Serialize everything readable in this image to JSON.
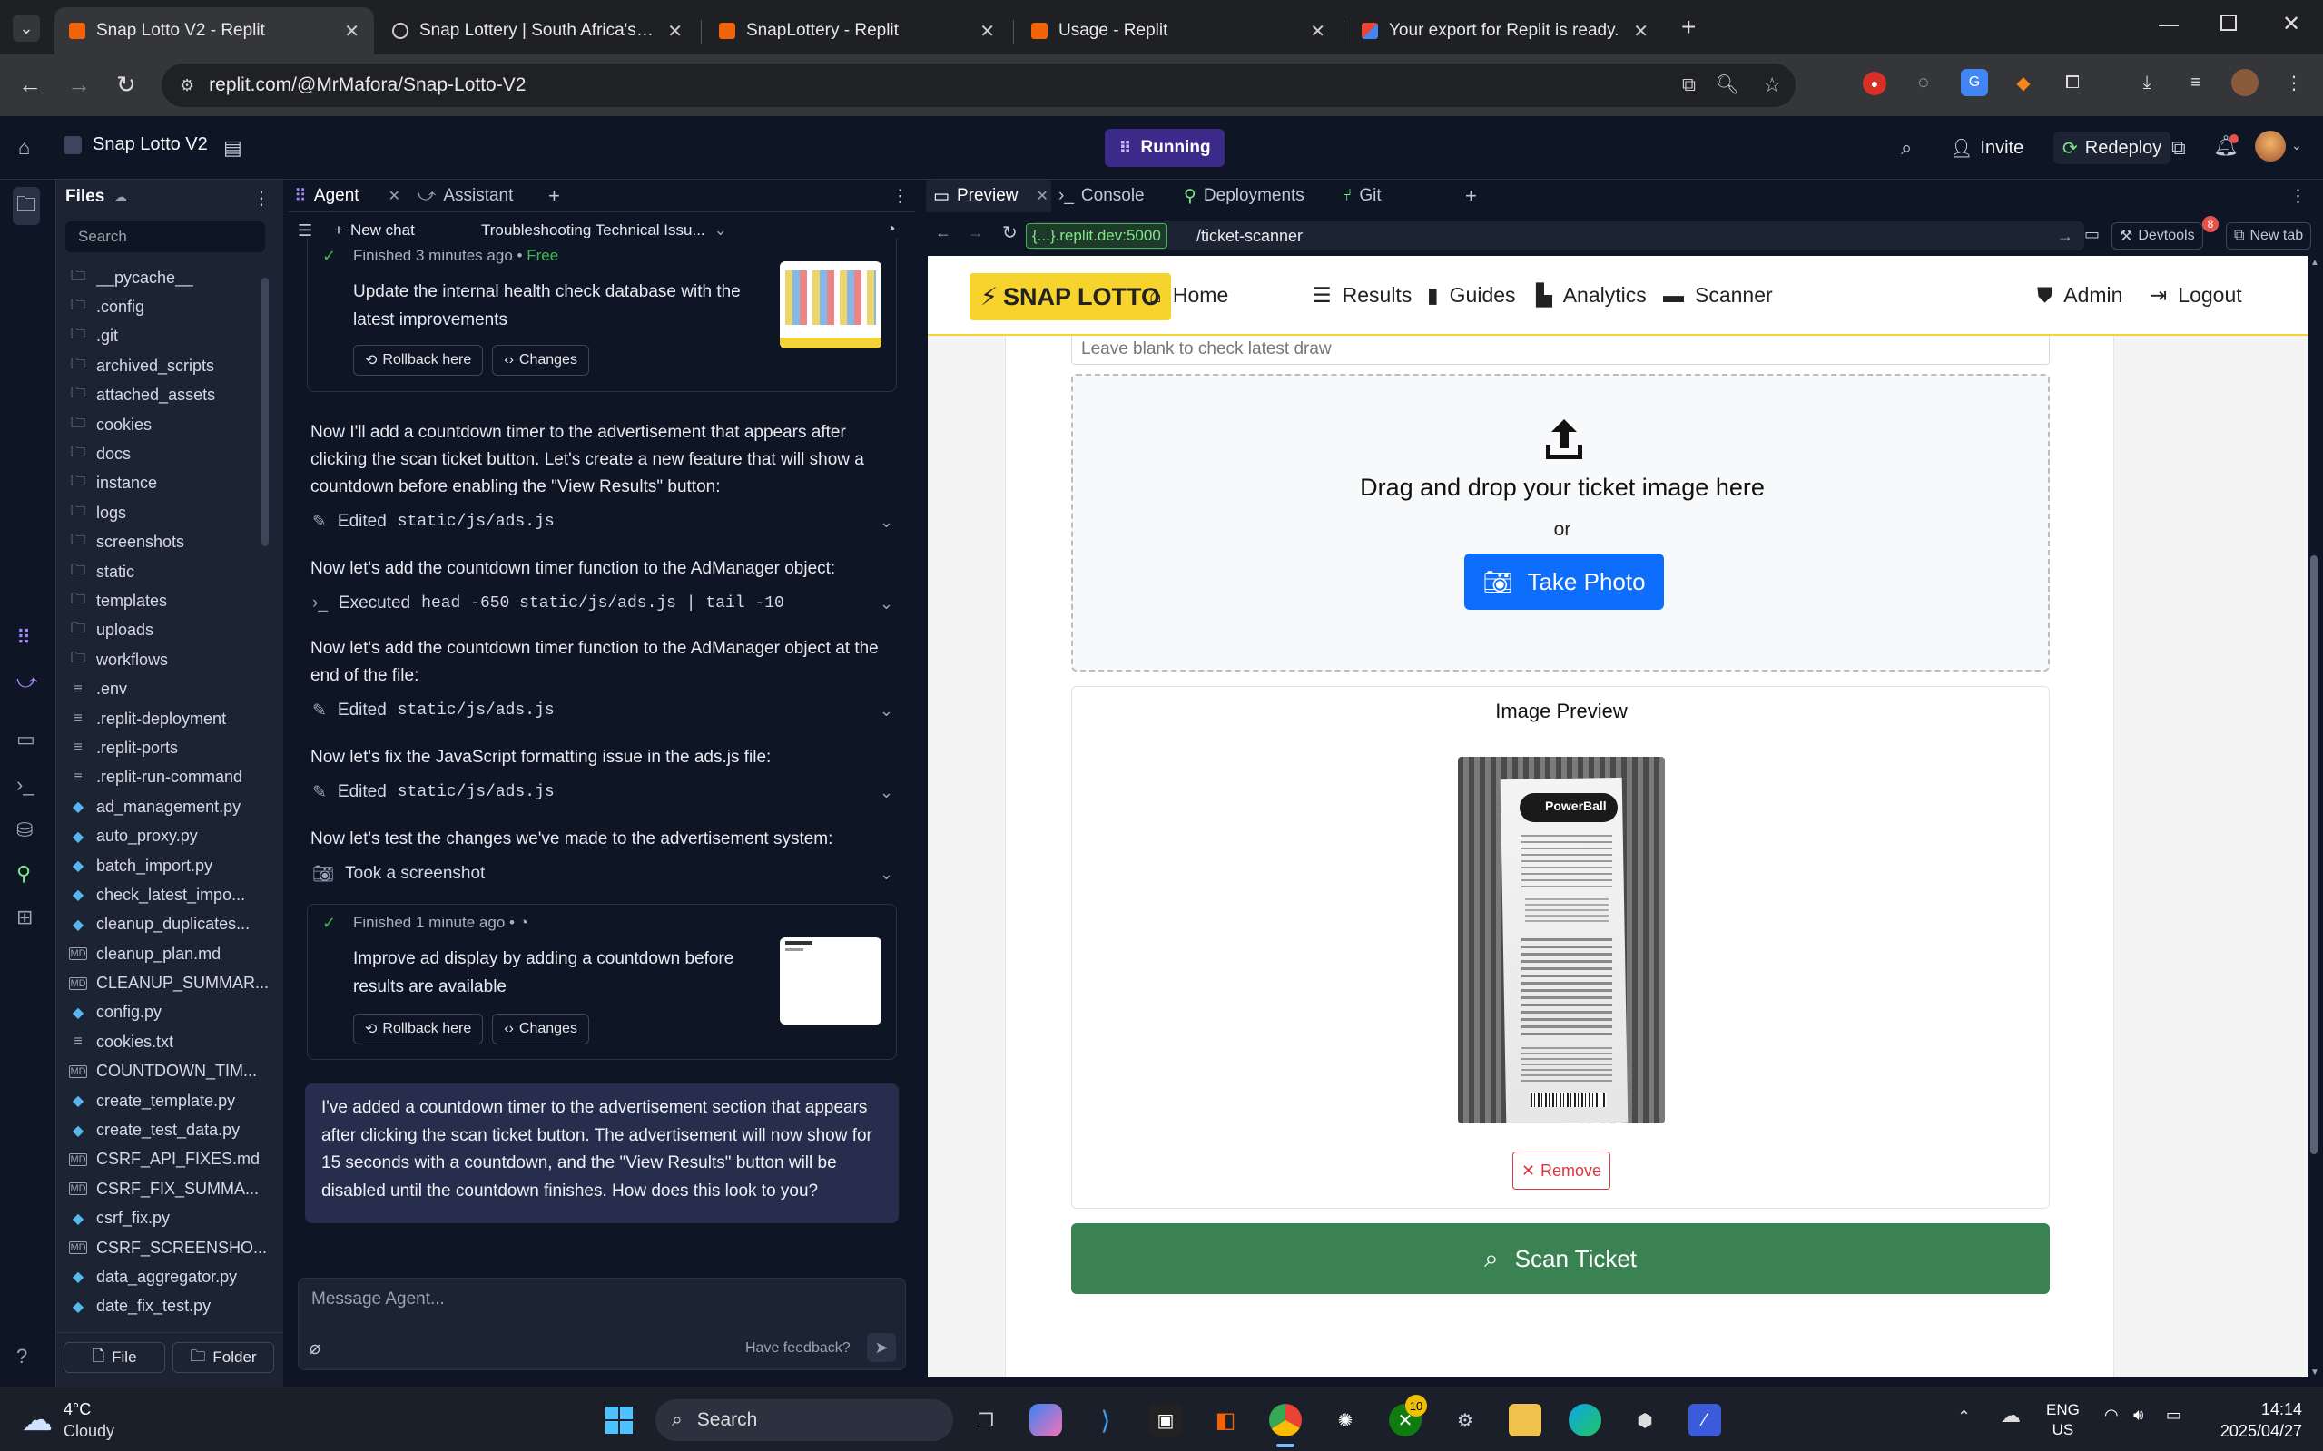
{
  "browser": {
    "tabs": [
      {
        "title": "Snap Lotto V2 - Replit",
        "active": true
      },
      {
        "title": "Snap Lottery | South Africa's #1",
        "active": false
      },
      {
        "title": "SnapLottery - Replit",
        "active": false
      },
      {
        "title": "Usage - Replit",
        "active": false
      },
      {
        "title": "Your export for Replit is ready.",
        "active": false
      }
    ],
    "url": "replit.com/@MrMafora/Snap-Lotto-V2"
  },
  "replit": {
    "project_name": "Snap Lotto V2",
    "status": "Running",
    "invite_label": "Invite",
    "redeploy_label": "Redeploy"
  },
  "files_panel": {
    "title": "Files",
    "search_placeholder": "Search",
    "items": [
      {
        "name": "__pycache__",
        "type": "folder"
      },
      {
        "name": ".config",
        "type": "folder"
      },
      {
        "name": ".git",
        "type": "folder"
      },
      {
        "name": "archived_scripts",
        "type": "folder"
      },
      {
        "name": "attached_assets",
        "type": "folder"
      },
      {
        "name": "cookies",
        "type": "folder"
      },
      {
        "name": "docs",
        "type": "folder"
      },
      {
        "name": "instance",
        "type": "folder"
      },
      {
        "name": "logs",
        "type": "folder"
      },
      {
        "name": "screenshots",
        "type": "folder"
      },
      {
        "name": "static",
        "type": "folder"
      },
      {
        "name": "templates",
        "type": "folder"
      },
      {
        "name": "uploads",
        "type": "folder"
      },
      {
        "name": "workflows",
        "type": "folder"
      },
      {
        "name": ".env",
        "type": "txt"
      },
      {
        "name": ".replit-deployment",
        "type": "txt"
      },
      {
        "name": ".replit-ports",
        "type": "txt"
      },
      {
        "name": ".replit-run-command",
        "type": "txt"
      },
      {
        "name": "ad_management.py",
        "type": "py"
      },
      {
        "name": "auto_proxy.py",
        "type": "py"
      },
      {
        "name": "batch_import.py",
        "type": "py"
      },
      {
        "name": "check_latest_impo...",
        "type": "py"
      },
      {
        "name": "cleanup_duplicates...",
        "type": "py"
      },
      {
        "name": "cleanup_plan.md",
        "type": "md"
      },
      {
        "name": "CLEANUP_SUMMAR...",
        "type": "md"
      },
      {
        "name": "config.py",
        "type": "py"
      },
      {
        "name": "cookies.txt",
        "type": "txt"
      },
      {
        "name": "COUNTDOWN_TIM...",
        "type": "md"
      },
      {
        "name": "create_template.py",
        "type": "py"
      },
      {
        "name": "create_test_data.py",
        "type": "py"
      },
      {
        "name": "CSRF_API_FIXES.md",
        "type": "md"
      },
      {
        "name": "CSRF_FIX_SUMMA...",
        "type": "md"
      },
      {
        "name": "csrf_fix.py",
        "type": "py"
      },
      {
        "name": "CSRF_SCREENSHO...",
        "type": "md"
      },
      {
        "name": "data_aggregator.py",
        "type": "py"
      },
      {
        "name": "date_fix_test.py",
        "type": "py"
      }
    ],
    "new_file_label": "File",
    "new_folder_label": "Folder"
  },
  "agent_panel": {
    "tabs": [
      "Agent",
      "Assistant"
    ],
    "new_chat_label": "New chat",
    "chat_title": "Troubleshooting Technical Issu...",
    "card1": {
      "meta": "Finished 3 minutes ago",
      "cost": "Free",
      "desc": "Update the internal health check database with the latest improvements",
      "rollback": "Rollback here",
      "changes": "Changes"
    },
    "msg1": "Now I'll add a countdown timer to the advertisement that appears after clicking the scan ticket button. Let's create a new feature that will show a countdown before enabling the \"View Results\" button:",
    "act1": {
      "label": "Edited",
      "target": "static/js/ads.js"
    },
    "msg2": "Now let's add the countdown timer function to the AdManager object:",
    "act2": {
      "label": "Executed",
      "target": "head -650 static/js/ads.js | tail -10"
    },
    "msg3": "Now let's add the countdown timer function to the AdManager object at the end of the file:",
    "act3": {
      "label": "Edited",
      "target": "static/js/ads.js"
    },
    "msg4": "Now let's fix the JavaScript formatting issue in the ads.js file:",
    "act4": {
      "label": "Edited",
      "target": "static/js/ads.js"
    },
    "msg5": "Now let's test the changes we've made to the advertisement system:",
    "act5": {
      "label": "Took a screenshot"
    },
    "card2": {
      "meta": "Finished 1 minute ago",
      "desc": "Improve ad display by adding a countdown before results are available",
      "rollback": "Rollback here",
      "changes": "Changes"
    },
    "final_message": "I've added a countdown timer to the advertisement section that appears after clicking the scan ticket button. The advertisement will now show for 15 seconds with a countdown, and the \"View Results\" button will be disabled until the countdown finishes. How does this look to you?",
    "composer_placeholder": "Message Agent...",
    "feedback_label": "Have feedback?"
  },
  "preview_panel": {
    "tabs": [
      "Preview",
      "Console",
      "Deployments",
      "Git"
    ],
    "url_host": "{...}.replit.dev:5000",
    "url_path": "/ticket-scanner",
    "devtools_label": "Devtools",
    "devtools_badge": "8",
    "new_tab_label": "New tab"
  },
  "site": {
    "brand": "SNAP LOTTO",
    "nav": [
      "Home",
      "Results",
      "Guides",
      "Analytics",
      "Scanner"
    ],
    "admin": "Admin",
    "logout": "Logout",
    "draw_input_placeholder": "Leave blank to check latest draw",
    "drop_title": "Drag and drop your ticket image here",
    "drop_or": "or",
    "take_photo": "Take Photo",
    "preview_title": "Image Preview",
    "ticket_brand": "PowerBall",
    "remove": "Remove",
    "scan": "Scan Ticket"
  },
  "taskbar": {
    "weather_temp": "4°C",
    "weather_desc": "Cloudy",
    "search_label": "Search",
    "xbox_badge": "10",
    "lang_top": "ENG",
    "lang_bottom": "US",
    "time": "14:14",
    "date": "2025/04/27"
  }
}
